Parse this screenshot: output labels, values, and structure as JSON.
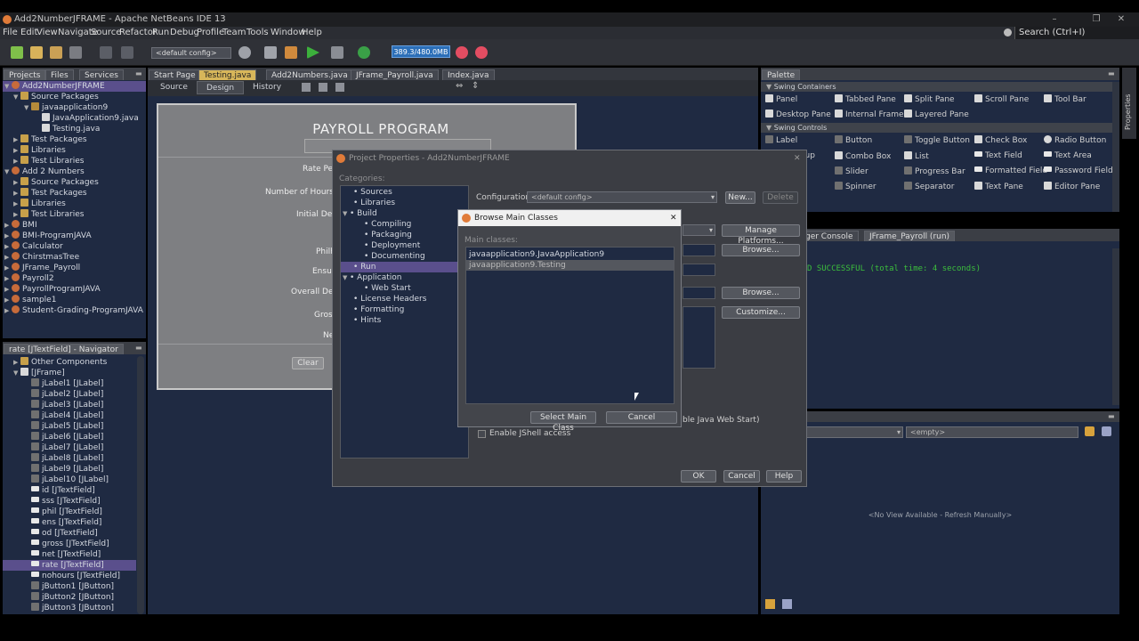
{
  "window": {
    "title": "Add2NumberJFRAME - Apache NetBeans IDE 13",
    "search_placeholder": "Search (Ctrl+I)"
  },
  "menu": [
    "File",
    "Edit",
    "View",
    "Navigate",
    "Source",
    "Refactor",
    "Run",
    "Debug",
    "Profile",
    "Team",
    "Tools",
    "Window",
    "Help"
  ],
  "toolbar": {
    "config": "<default config>",
    "memory": "389.3/480.0MB"
  },
  "projects_panel": {
    "tabs": [
      "Projects",
      "Files",
      "Services"
    ],
    "items": [
      "Add2NumberJFRAME",
      "Source Packages",
      "javaapplication9",
      "JavaApplication9.java",
      "Testing.java",
      "Test Packages",
      "Libraries",
      "Test Libraries",
      "Add 2 Numbers",
      "Source Packages",
      "Test Packages",
      "Libraries",
      "Test Libraries",
      "BMI",
      "BMI-ProgramJAVA",
      "Calculator",
      "ChirstmasTree",
      "JFrame_Payroll",
      "Payroll2",
      "PayrollProgramJAVA",
      "sample1",
      "Student-Grading-ProgramJAVA"
    ]
  },
  "navigator": {
    "title": "rate [JTextField] - Navigator",
    "items": [
      "Other Components",
      "[JFrame]",
      "jLabel1 [JLabel]",
      "jLabel2 [JLabel]",
      "jLabel3 [JLabel]",
      "jLabel4 [JLabel]",
      "jLabel5 [JLabel]",
      "jLabel6 [JLabel]",
      "jLabel7 [JLabel]",
      "jLabel8 [JLabel]",
      "jLabel9 [JLabel]",
      "jLabel10 [JLabel]",
      "id [JTextField]",
      "sss [JTextField]",
      "phil [JTextField]",
      "ens [JTextField]",
      "od [JTextField]",
      "gross [JTextField]",
      "net [JTextField]",
      "rate [JTextField]",
      "nohours [JTextField]",
      "jButton1 [JButton]",
      "jButton2 [JButton]",
      "jButton3 [JButton]"
    ]
  },
  "editor": {
    "tabs": [
      "Start Page",
      "Testing.java",
      "Add2Numbers.java",
      "JFrame_Payroll.java",
      "Index.java"
    ],
    "modes": [
      "Source",
      "Design",
      "History"
    ],
    "form_title": "PAYROLL PROGRAM",
    "form_labels": [
      "Rate Per",
      "Number of Hours Wo",
      "Initial Dedu",
      "Philh",
      "Ensu",
      "Overall Dedu",
      "Gros",
      "Ne"
    ],
    "clear_button": "Clear"
  },
  "palette": {
    "title": "Palette",
    "containers_header": "Swing Containers",
    "containers": [
      "Panel",
      "Tabbed Pane",
      "Split Pane",
      "Scroll Pane",
      "Tool Bar",
      "Desktop Pane",
      "Internal Frame",
      "Layered Pane"
    ],
    "controls_header": "Swing Controls",
    "controls": [
      "Label",
      "Button",
      "Toggle Button",
      "Check Box",
      "Radio Button",
      "oup",
      "Combo Box",
      "List",
      "Text Field",
      "Text Area",
      "Slider",
      "Progress Bar",
      "Formatted Field",
      "Password Field",
      "Spinner",
      "Separator",
      "Text Pane",
      "Editor Pane"
    ]
  },
  "output": {
    "tabs": [
      "ger Console",
      "JFrame_Payroll (run)"
    ],
    "text": "D SUCCESSFUL (total time: 4 seconds)"
  },
  "properties": {
    "empty_combo": "<empty>",
    "no_view": "<No View Available - Refresh Manually>",
    "side_tab": "Properties"
  },
  "project_properties": {
    "title": "Project Properties - Add2NumberJFRAME",
    "categories_label": "Categories:",
    "categories": [
      "Sources",
      "Libraries",
      "Build",
      "Compiling",
      "Packaging",
      "Deployment",
      "Documenting",
      "Run",
      "Application",
      "Web Start",
      "License Headers",
      "Formatting",
      "Hints"
    ],
    "configuration_label": "Configuration:",
    "configuration_value": "<default config>",
    "new_button": "New...",
    "delete_button": "Delete",
    "manage_platforms": "Manage Platforms...",
    "browse1": "Browse...",
    "browse2": "Browse...",
    "customize": "Customize...",
    "web_start_check": "ble Java Web Start)",
    "jshell_check": "Enable JShell access",
    "ok": "OK",
    "cancel": "Cancel",
    "help": "Help"
  },
  "browse_main": {
    "title": "Browse Main Classes",
    "label": "Main classes:",
    "classes": [
      "javaapplication9.JavaApplication9",
      "javaapplication9.Testing"
    ],
    "select_button": "Select Main Class",
    "cancel_button": "Cancel"
  }
}
